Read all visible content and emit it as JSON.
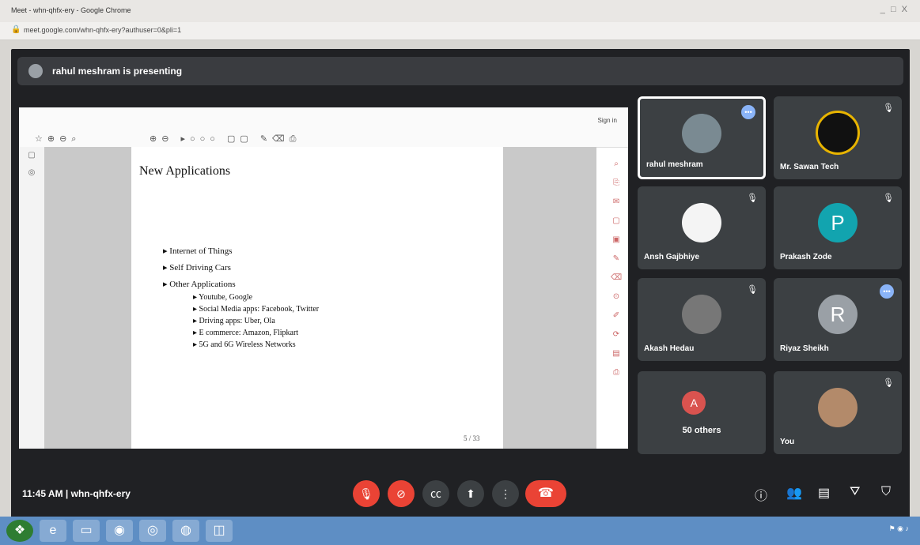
{
  "window": {
    "title": "Meet - whn-qhfx-ery - Google Chrome",
    "controls": "_ □ X",
    "url": "meet.google.com/whn-qhfx-ery?authuser=0&pli=1"
  },
  "meet": {
    "presenting_text": "rahul meshram is presenting",
    "time_meeting": "11:45 AM  |  whn-qhfx-ery",
    "slide": {
      "title": "New Applications",
      "bullets": [
        "Internet of Things",
        "Self Driving Cars",
        "Other Applications"
      ],
      "subbullets": [
        "Youtube, Google",
        "Social Media apps: Facebook, Twitter",
        "Driving apps: Uber, Ola",
        "E commerce: Amazon, Flipkart",
        "5G and 6G Wireless Networks"
      ],
      "page": "5 / 33",
      "sign_in": "Sign in"
    },
    "participants": [
      {
        "name": "rahul meshram"
      },
      {
        "name": "Mr. Sawan Tech"
      },
      {
        "name": "Ansh Gajbhiye"
      },
      {
        "name": "Prakash Zode",
        "initial": "P"
      },
      {
        "name": "Akash Hedau"
      },
      {
        "name": "Riyaz Sheikh",
        "initial": "R"
      },
      {
        "name": "50 others",
        "initial": "A"
      },
      {
        "name": "You"
      }
    ]
  },
  "colors": {
    "accent_red": "#ea4335",
    "meet_bg": "#202124",
    "tile_bg": "#3c4043",
    "teal": "#12a4af",
    "gray_avatar": "#9aa0a6"
  }
}
